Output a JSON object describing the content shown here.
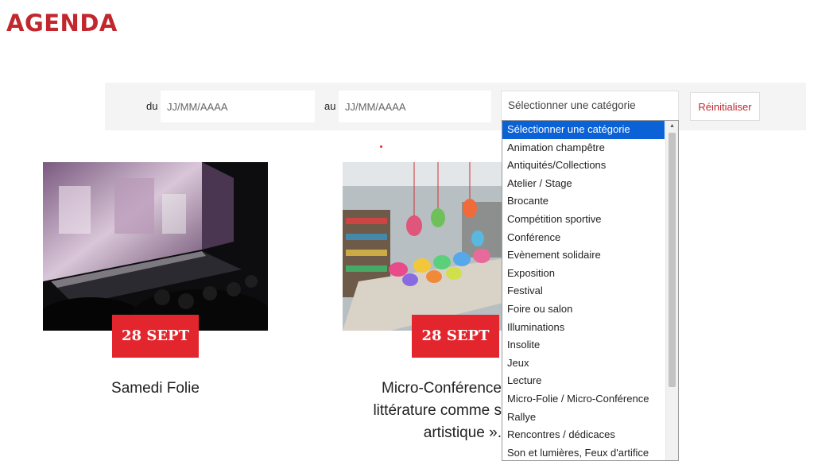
{
  "page": {
    "title": "AGENDA"
  },
  "filters": {
    "from_label": "du",
    "from_placeholder": "JJ/MM/AAAA",
    "to_label": "au",
    "to_placeholder": "JJ/MM/AAAA",
    "category_selected": "Sélectionner une catégorie",
    "reset_label": "Réinitialiser"
  },
  "events": [
    {
      "date": "28 SEPT",
      "title": "Samedi Folie"
    },
    {
      "date": "28 SEPT",
      "title_lines": [
        "Micro-Conférence",
        "littérature comme s",
        "artistique »."
      ]
    }
  ],
  "dropdown": {
    "options": [
      "Sélectionner une catégorie",
      "Animation champêtre",
      "Antiquités/Collections",
      "Atelier / Stage",
      "Brocante",
      "Compétition sportive",
      "Conférence",
      "Evènement solidaire",
      "Exposition",
      "Festival",
      "Foire ou salon",
      "Illuminations",
      "Insolite",
      "Jeux",
      "Lecture",
      "Micro-Folie / Micro-Conférence",
      "Rallye",
      "Rencontres / dédicaces",
      "Son et lumières, Feux d'artifice"
    ],
    "selected_index": 0
  },
  "colors": {
    "brand": "#c1272d",
    "badge": "#e3262e",
    "highlight": "#0b62d6"
  }
}
